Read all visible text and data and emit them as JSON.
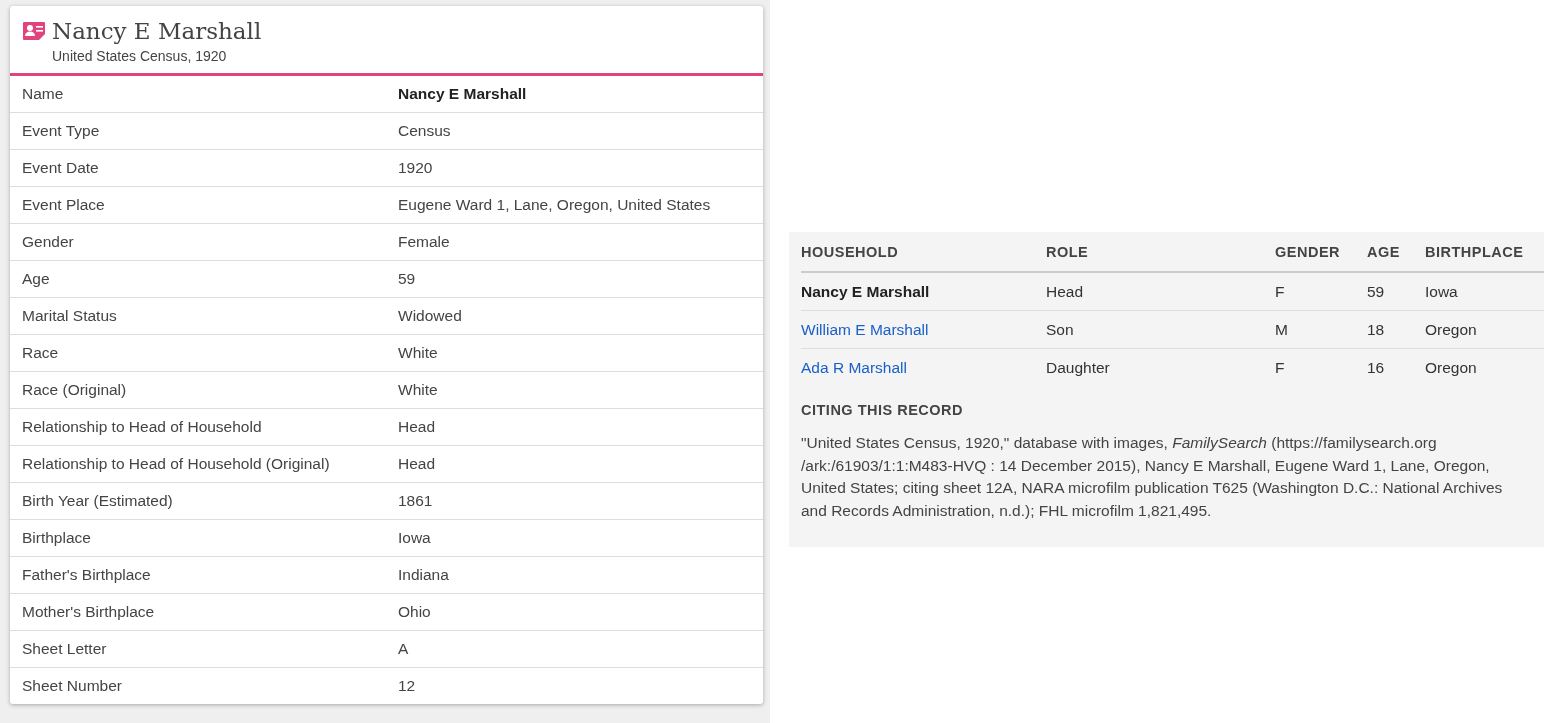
{
  "record": {
    "name": "Nancy E Marshall",
    "collection": "United States Census, 1920",
    "fields": [
      {
        "label": "Name",
        "value": "Nancy E Marshall",
        "bold": true
      },
      {
        "label": "Event Type",
        "value": "Census",
        "bold": false
      },
      {
        "label": "Event Date",
        "value": "1920",
        "bold": false
      },
      {
        "label": "Event Place",
        "value": "Eugene Ward 1, Lane, Oregon, United States",
        "bold": false
      },
      {
        "label": "Gender",
        "value": "Female",
        "bold": false
      },
      {
        "label": "Age",
        "value": "59",
        "bold": false
      },
      {
        "label": "Marital Status",
        "value": "Widowed",
        "bold": false
      },
      {
        "label": "Race",
        "value": "White",
        "bold": false
      },
      {
        "label": "Race (Original)",
        "value": "White",
        "bold": false
      },
      {
        "label": "Relationship to Head of Household",
        "value": "Head",
        "bold": false
      },
      {
        "label": "Relationship to Head of Household (Original)",
        "value": "Head",
        "bold": false
      },
      {
        "label": "Birth Year (Estimated)",
        "value": "1861",
        "bold": false
      },
      {
        "label": "Birthplace",
        "value": "Iowa",
        "bold": false
      },
      {
        "label": "Father's Birthplace",
        "value": "Indiana",
        "bold": false
      },
      {
        "label": "Mother's Birthplace",
        "value": "Ohio",
        "bold": false
      },
      {
        "label": "Sheet Letter",
        "value": "A",
        "bold": false
      },
      {
        "label": "Sheet Number",
        "value": "12",
        "bold": false
      }
    ]
  },
  "household": {
    "columns": [
      "HOUSEHOLD",
      "ROLE",
      "GENDER",
      "AGE",
      "BIRTHPLACE"
    ],
    "rows": [
      {
        "kind": "current",
        "name": "Nancy E Marshall",
        "role": "Head",
        "gender": "F",
        "age": "59",
        "birthplace": "Iowa"
      },
      {
        "kind": "link",
        "name": "William E Marshall",
        "role": "Son",
        "gender": "M",
        "age": "18",
        "birthplace": "Oregon"
      },
      {
        "kind": "link",
        "name": "Ada R Marshall",
        "role": "Daughter",
        "gender": "F",
        "age": "16",
        "birthplace": "Oregon"
      }
    ]
  },
  "citation": {
    "heading": "CITING THIS RECORD",
    "text": "\"United States Census, 1920,\" database with images, *FamilySearch* (https://familysearch.org /ark:/61903/1:1:M483-HVQ : 14 December 2015), Nancy E Marshall, Eugene Ward 1, Lane, Oregon, United States; citing sheet 12A, NARA microfilm publication T625 (Washington D.C.: National Archives and Records Administration, n.d.); FHL microfilm 1,821,495."
  }
}
